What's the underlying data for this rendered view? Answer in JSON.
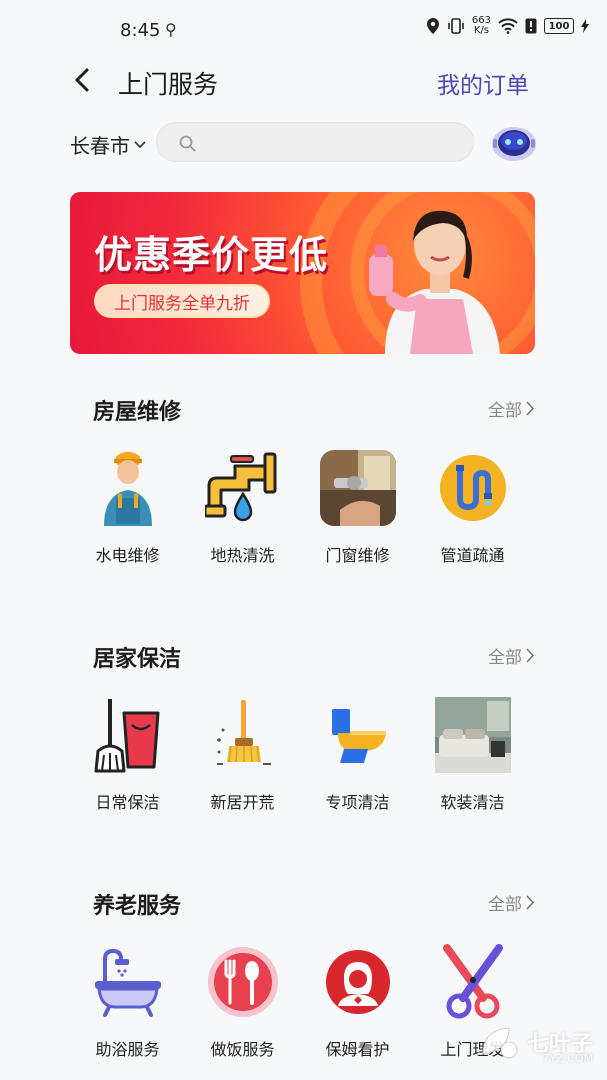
{
  "status": {
    "time": "8:45",
    "net_speed_value": "663",
    "net_speed_unit": "K/s",
    "battery": "100"
  },
  "header": {
    "title": "上门服务",
    "orders_link": "我的订单"
  },
  "search": {
    "city": "长春市",
    "placeholder": ""
  },
  "banner": {
    "title": "优惠季价更低",
    "pill": "上门服务全单九折"
  },
  "sections": [
    {
      "title": "房屋维修",
      "more": "全部",
      "items": [
        {
          "label": "水电维修",
          "icon": "plumber-icon"
        },
        {
          "label": "地热清洗",
          "icon": "pipe-faucet-icon"
        },
        {
          "label": "门窗维修",
          "icon": "door-lock-photo-icon"
        },
        {
          "label": "管道疏通",
          "icon": "drain-pipe-icon"
        }
      ]
    },
    {
      "title": "居家保洁",
      "more": "全部",
      "items": [
        {
          "label": "日常保洁",
          "icon": "broom-bucket-icon"
        },
        {
          "label": "新居开荒",
          "icon": "mop-icon"
        },
        {
          "label": "专项清洁",
          "icon": "toilet-icon"
        },
        {
          "label": "软装清洁",
          "icon": "sofa-photo-icon"
        }
      ]
    },
    {
      "title": "养老服务",
      "more": "全部",
      "items": [
        {
          "label": "助浴服务",
          "icon": "bathtub-icon"
        },
        {
          "label": "做饭服务",
          "icon": "cooking-icon"
        },
        {
          "label": "保姆看护",
          "icon": "nanny-icon"
        },
        {
          "label": "上门理发",
          "icon": "scissors-icon"
        }
      ]
    }
  ],
  "watermark": {
    "text": "七叶子",
    "sub": "7YZ.COM"
  },
  "colors": {
    "accent": "#4a4ab4",
    "banner_red": "#f2293c"
  }
}
